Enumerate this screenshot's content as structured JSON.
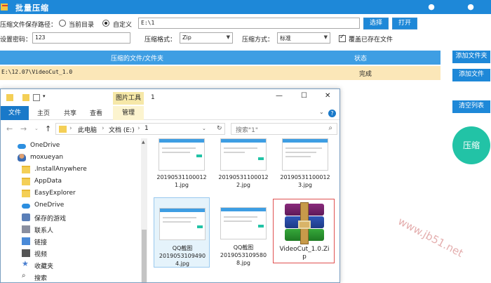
{
  "app": {
    "title": "批量压缩",
    "minimize": "●",
    "close": "●"
  },
  "options": {
    "save_path_label": "压缩文件保存路径：",
    "radio_current_dir": "当前目录",
    "radio_custom": "自定义",
    "path_value": "E:\\1",
    "select_button": "选择",
    "open_button": "打开",
    "password_label": "设置密码：",
    "password_value": "123",
    "format_label": "压缩格式：",
    "format_value": "Zip",
    "method_label": "压缩方式：",
    "method_value": "标准",
    "overwrite_label": "覆盖已存在文件"
  },
  "table": {
    "col_file": "压缩的文件/文件夹",
    "col_status": "状态",
    "rows": [
      {
        "file": "E:\\12.07\\VideoCut_1.0",
        "status": "完成"
      }
    ]
  },
  "side": {
    "add_folder": "添加文件夹",
    "add_file": "添加文件",
    "clear_list": "清空列表",
    "compress": "压缩"
  },
  "explorer": {
    "tools_tab": "图片工具",
    "title": "1",
    "ribbon_tabs": [
      "文件",
      "主页",
      "共享",
      "查看",
      "管理"
    ],
    "breadcrumb": [
      "此电脑",
      "文档 (E:)",
      "1"
    ],
    "search_placeholder": "搜索\"1\"",
    "nav_items": [
      {
        "label": "OneDrive",
        "icon": "onedrive-icon"
      },
      {
        "label": "moxueyan",
        "icon": "user-icon"
      },
      {
        "label": ".InstallAnywhere",
        "icon": "folder-icon"
      },
      {
        "label": "AppData",
        "icon": "folder-icon"
      },
      {
        "label": "EasyExplorer",
        "icon": "folder-icon"
      },
      {
        "label": "OneDrive",
        "icon": "onedrive-icon"
      },
      {
        "label": "保存的游戏",
        "icon": "games-icon"
      },
      {
        "label": "联系人",
        "icon": "contacts-icon"
      },
      {
        "label": "链接",
        "icon": "links-icon"
      },
      {
        "label": "视频",
        "icon": "video-icon"
      },
      {
        "label": "收藏夹",
        "icon": "star-icon"
      },
      {
        "label": "搜索",
        "icon": "search-icon"
      }
    ],
    "files": [
      {
        "name_l1": "20190531100012",
        "name_l2": "1.jpg"
      },
      {
        "name_l1": "20190531100012",
        "name_l2": "2.jpg"
      },
      {
        "name_l1": "20190531100012",
        "name_l2": "3.jpg"
      },
      {
        "name_l1": "QQ截图",
        "name_l2": "2019053109490",
        "name_l3": "4.jpg"
      },
      {
        "name_l1": "QQ截图",
        "name_l2": "2019053109580",
        "name_l3": "8.jpg"
      },
      {
        "name_l1": "VideoCut_1.0.Zi",
        "name_l2": "p"
      }
    ]
  },
  "watermark": "www.jb51.net",
  "colors": {
    "accent": "#1e88d8",
    "header_blue": "#3e9ee3",
    "row_highlight": "#fbe7b8",
    "compress_green": "#22c3a6"
  }
}
